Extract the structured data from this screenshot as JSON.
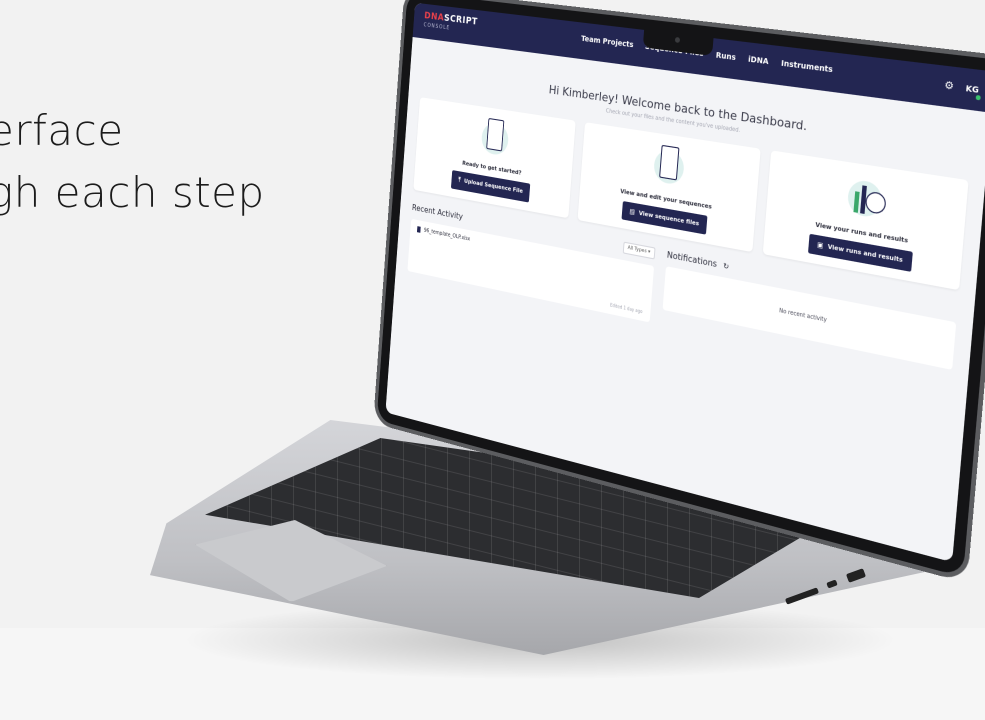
{
  "marketing": {
    "line1": "erface",
    "line2": "gh each step"
  },
  "app": {
    "logo_dna": "DNA",
    "logo_script": "SCRIPT",
    "logo_sub": "CONSOLE",
    "nav": [
      "Team Projects",
      "Sequence Files",
      "Runs",
      "iDNA",
      "Instruments"
    ],
    "user_initials": "KG",
    "gear_icon": "gear-icon"
  },
  "welcome": {
    "title": "Hi Kimberley! Welcome back to the Dashboard.",
    "subtitle": "Check out your files and the content you've uploaded."
  },
  "cards": [
    {
      "label": "Ready to get started?",
      "button": "Upload Sequence File",
      "icon": "upload-icon"
    },
    {
      "label": "View and edit your sequences",
      "button": "View sequence files",
      "icon": "file-icon"
    },
    {
      "label": "View your runs and results",
      "button": "View runs and results",
      "icon": "results-icon"
    }
  ],
  "recent": {
    "title": "Recent Activity",
    "filter": "All Types",
    "file_name": "96_template_OLP.xlsx",
    "time": "Edited 1 day ago"
  },
  "notifications": {
    "title": "Notifications",
    "empty": "No recent activity"
  }
}
